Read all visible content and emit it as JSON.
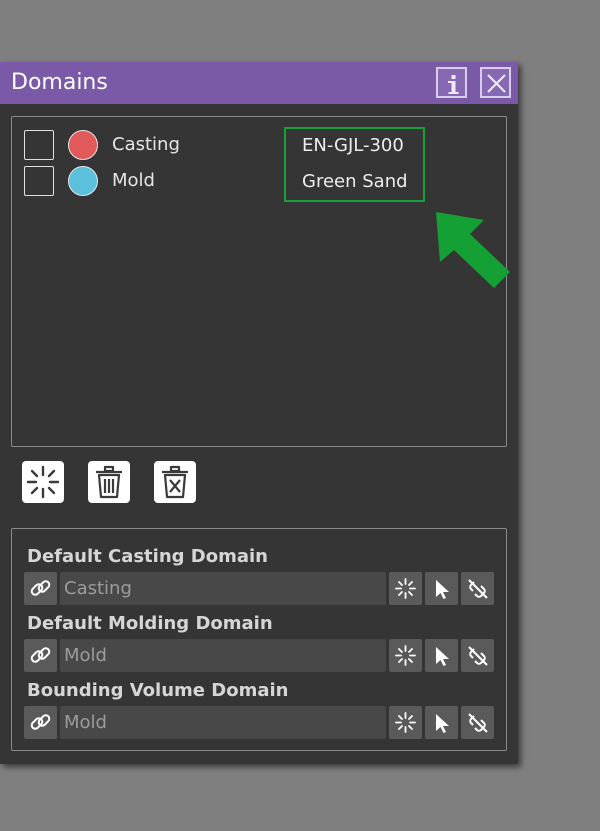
{
  "window": {
    "title": "Domains"
  },
  "domains": [
    {
      "name": "Casting",
      "color": "#e05a5a",
      "material": "EN-GJL-300",
      "checked": false
    },
    {
      "name": "Mold",
      "color": "#5bc0dc",
      "material": "Green Sand",
      "checked": false
    }
  ],
  "annotation": {
    "highlight_color": "#18a038",
    "arrow_color": "#14a034"
  },
  "actions": [
    {
      "icon": "add-sparkle-icon"
    },
    {
      "icon": "trash-icon"
    },
    {
      "icon": "delete-all-icon"
    }
  ],
  "defaults": [
    {
      "label": "Default Casting Domain",
      "value": "Casting"
    },
    {
      "label": "Default Molding Domain",
      "value": "Mold"
    },
    {
      "label": "Bounding Volume Domain",
      "value": "Mold"
    }
  ],
  "colors": {
    "titlebar": "#7a5aa6",
    "panel": "#353535",
    "background": "#7f7f7f"
  }
}
